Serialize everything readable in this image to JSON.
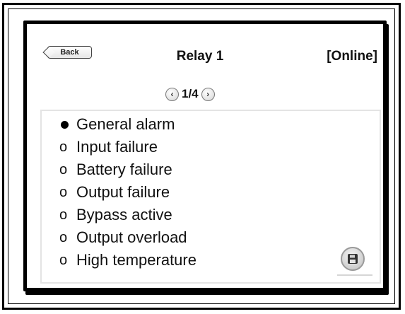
{
  "header": {
    "back_label": "Back",
    "title": "Relay 1",
    "status": "[Online]"
  },
  "pager": {
    "indicator": "1/4",
    "prev_symbol": "‹",
    "next_symbol": "›"
  },
  "alarm_list": {
    "items": [
      {
        "label": "General alarm",
        "selected": true,
        "marker": "●"
      },
      {
        "label": "Input failure",
        "selected": false,
        "marker": "o"
      },
      {
        "label": "Battery failure",
        "selected": false,
        "marker": "o"
      },
      {
        "label": "Output failure",
        "selected": false,
        "marker": "o"
      },
      {
        "label": "Bypass active",
        "selected": false,
        "marker": "o"
      },
      {
        "label": "Output overload",
        "selected": false,
        "marker": "o"
      },
      {
        "label": "High temperature",
        "selected": false,
        "marker": "o"
      }
    ]
  },
  "icons": {
    "save": "save-icon",
    "prev": "chevron-left-icon",
    "next": "chevron-right-icon"
  }
}
